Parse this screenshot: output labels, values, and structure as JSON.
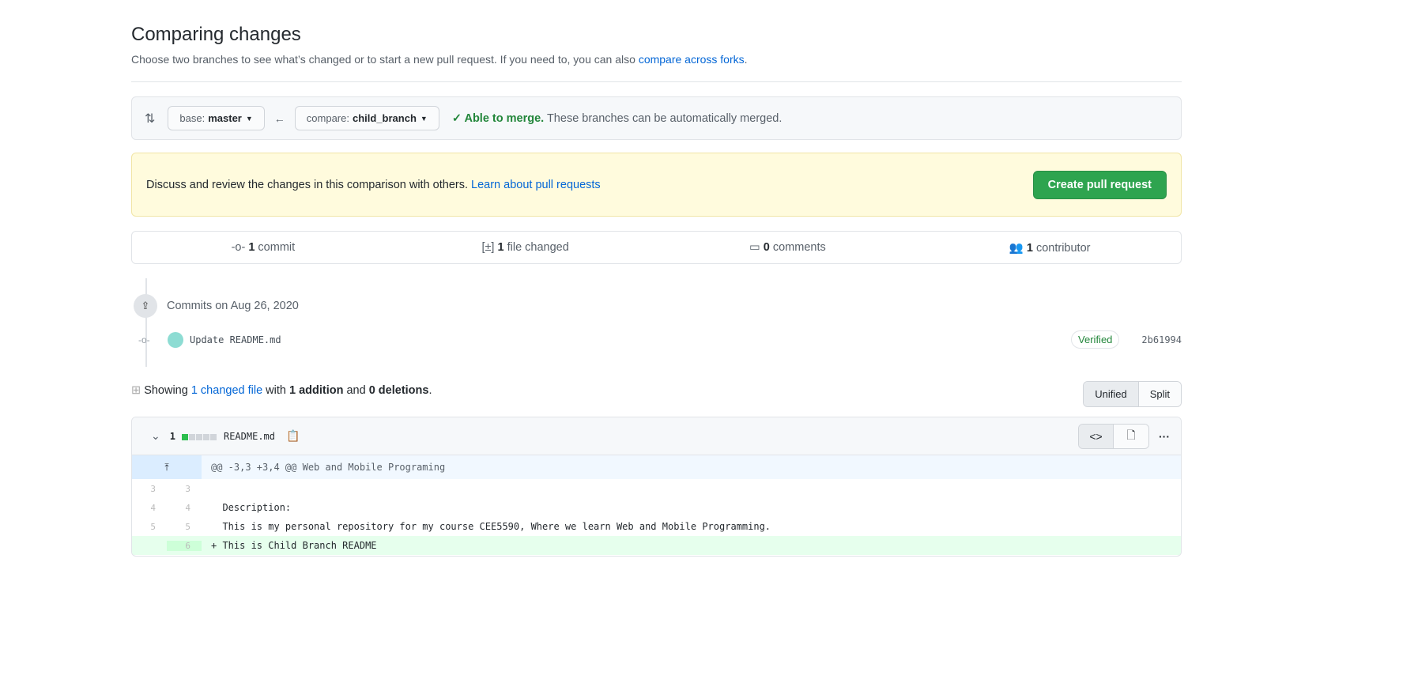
{
  "header": {
    "title": "Comparing changes",
    "subtitle": "Choose two branches to see what’s changed or to start a new pull request. If you need to, you can also ",
    "subtitle_link": "compare across forks",
    "subtitle_end": "."
  },
  "range": {
    "base_label": "base:",
    "base": "master",
    "compare_label": "compare:",
    "compare": "child_branch",
    "merge_status": "Able to merge.",
    "merge_text": " These branches can be automatically merged."
  },
  "flash": {
    "text": "Discuss and review the changes in this comparison with others. ",
    "link": "Learn about pull requests",
    "button": "Create pull request"
  },
  "stats": {
    "commits": "1",
    "commits_label": " commit",
    "files": "1",
    "files_label": " file changed",
    "comments": "0",
    "comments_label": " comments",
    "contributors": "1",
    "contributors_label": " contributor"
  },
  "commits": {
    "date": "Commits on Aug 26, 2020",
    "items": [
      {
        "message": "Update README.md",
        "badge": "Verified",
        "sha": "2b61994"
      }
    ]
  },
  "summary": {
    "prefix": "Showing ",
    "changed": "1 changed file",
    "with": " with ",
    "additions": "1 addition",
    "and": " and ",
    "deletions": "0 deletions",
    "end": "."
  },
  "view_toggle": {
    "unified": "Unified",
    "split": "Split",
    "selected": "Unified"
  },
  "file": {
    "changes": "1",
    "name": "README.md",
    "hunk": "@@ -3,3 +3,4 @@ Web and Mobile Programing",
    "lines": [
      {
        "old": "3",
        "new": "3",
        "text": " "
      },
      {
        "old": "4",
        "new": "4",
        "text": "  Description:"
      },
      {
        "old": "5",
        "new": "5",
        "text": "  This is my personal repository for my course CEE5590, Where we learn Web and Mobile Programming."
      },
      {
        "old": "",
        "new": "6",
        "text": "+ This is Child Branch README"
      }
    ]
  },
  "colors": {
    "green": "#2ea44f",
    "link": "#0366d6",
    "addition_bg": "#e6ffed",
    "hunk_bg": "#f1f8ff"
  }
}
